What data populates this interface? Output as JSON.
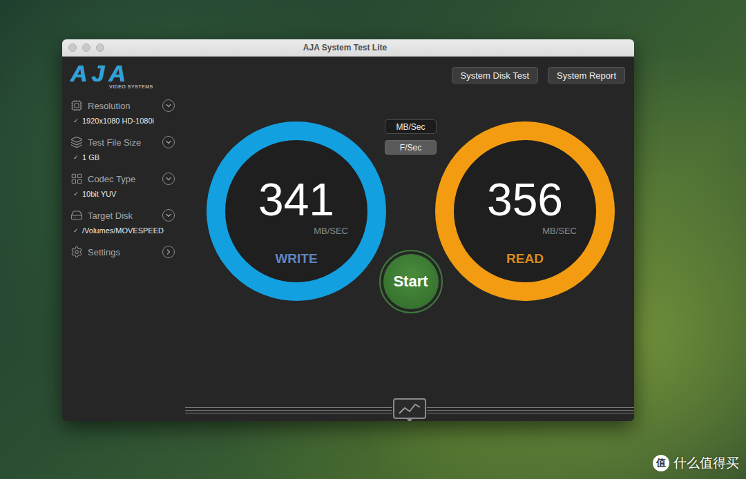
{
  "window": {
    "title": "AJA System Test Lite"
  },
  "logo": {
    "name": "AJA",
    "subtitle": "VIDEO SYSTEMS"
  },
  "sidebar": {
    "items": [
      {
        "label": "Resolution",
        "value": "1920x1080 HD-1080i",
        "check": "✓",
        "kind": "dropdown"
      },
      {
        "label": "Test File Size",
        "value": "1 GB",
        "check": "✓",
        "kind": "dropdown"
      },
      {
        "label": "Codec Type",
        "value": "10bit YUV",
        "check": "✓",
        "kind": "dropdown"
      },
      {
        "label": "Target Disk",
        "value": "/Volumes/MOVESPEED",
        "check": "✓",
        "kind": "dropdown"
      },
      {
        "label": "Settings",
        "kind": "link"
      }
    ]
  },
  "header_buttons": [
    "System Disk Test",
    "System Report"
  ],
  "units": [
    {
      "label": "MB/Sec",
      "selected": true
    },
    {
      "label": "F/Sec",
      "selected": false
    }
  ],
  "gauges": [
    {
      "value": "341",
      "unit": "MB/SEC",
      "label": "WRITE",
      "color": "#12a0e0",
      "label_color": "#5f86c4"
    },
    {
      "value": "356",
      "unit": "MB/SEC",
      "label": "READ",
      "color": "#f39c12",
      "label_color": "#d98a1a"
    }
  ],
  "start_button": "Start",
  "watermark": {
    "logo": "值",
    "text": "什么值得买"
  }
}
